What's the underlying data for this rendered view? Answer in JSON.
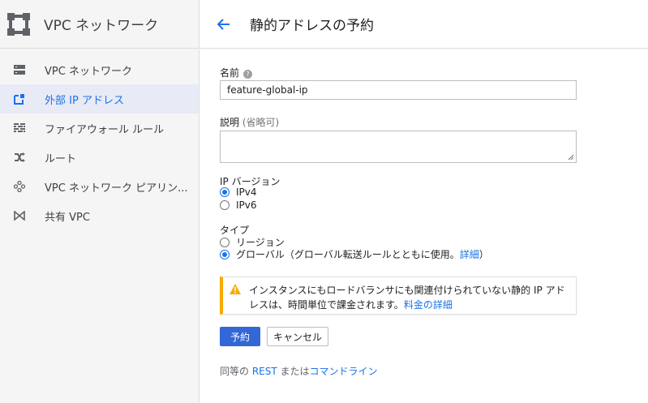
{
  "app": {
    "title": "VPC ネットワーク"
  },
  "sidebar": {
    "items": [
      {
        "label": "VPC ネットワーク",
        "icon": "vpc-network-icon",
        "active": false
      },
      {
        "label": "外部 IP アドレス",
        "icon": "external-ip-icon",
        "active": true
      },
      {
        "label": "ファイアウォール ルール",
        "icon": "firewall-icon",
        "active": false
      },
      {
        "label": "ルート",
        "icon": "routes-icon",
        "active": false
      },
      {
        "label": "VPC ネットワーク ピアリン...",
        "icon": "peering-icon",
        "active": false
      },
      {
        "label": "共有 VPC",
        "icon": "shared-vpc-icon",
        "active": false
      }
    ]
  },
  "header": {
    "title": "静的アドレスの予約"
  },
  "form": {
    "name_label": "名前",
    "name_value": "feature-global-ip",
    "description_label": "説明",
    "description_hint": "(省略可)",
    "ip_version_label": "IP バージョン",
    "ip_versions": [
      {
        "label": "IPv4",
        "selected": true
      },
      {
        "label": "IPv6",
        "selected": false
      }
    ],
    "type_label": "タイプ",
    "types": {
      "regional": "リージョン",
      "global": "グローバル（グローバル転送ルールとともに使用。",
      "global_link": "詳細",
      "global_suffix": "）"
    },
    "selected_type": "global"
  },
  "warning": {
    "text": "インスタンスにもロードバランサにも関連付けられていない静的 IP アドレスは、時間単位で課金されます。",
    "link": "料金の詳細"
  },
  "actions": {
    "reserve": "予約",
    "cancel": "キャンセル"
  },
  "footer": {
    "prefix": "同等の ",
    "rest": "REST",
    "middle": " または",
    "cli": "コマンドライン"
  },
  "colors": {
    "accent": "#1a73e8",
    "primary_button": "#3367d6",
    "warning": "#f9ab00",
    "active_bg": "#e8eaf6"
  }
}
